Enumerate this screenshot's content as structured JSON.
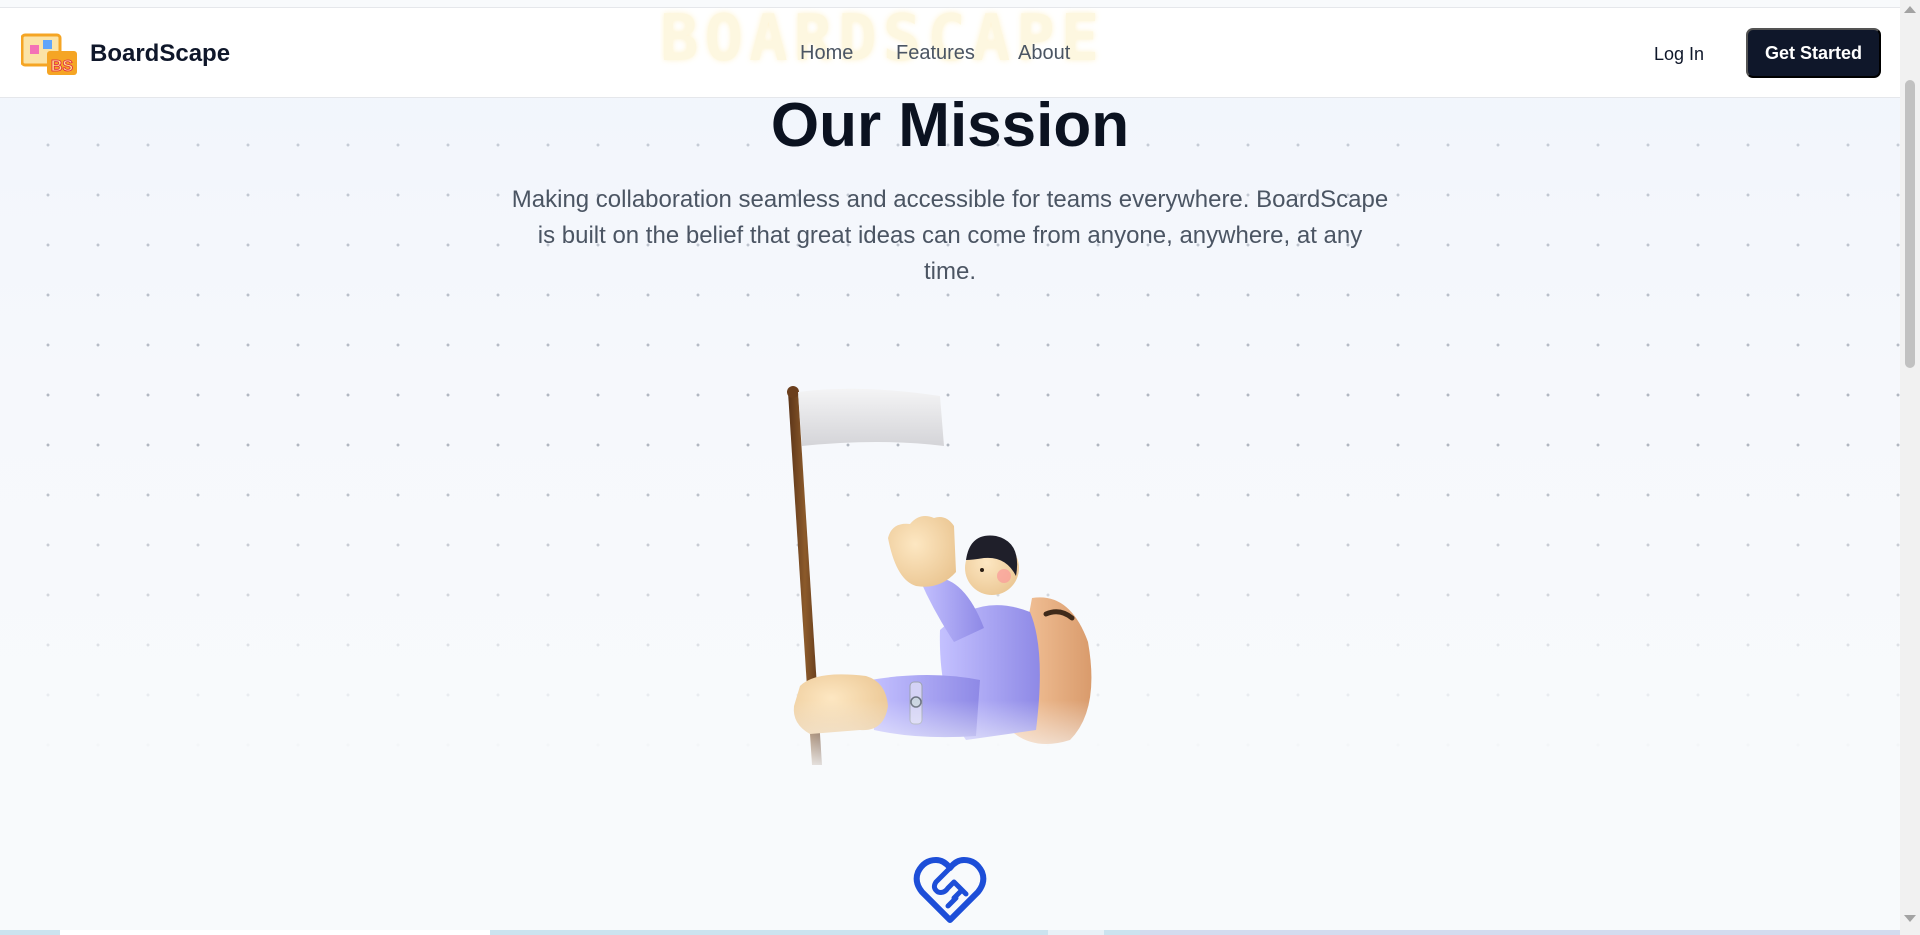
{
  "header": {
    "brand": "BoardScape",
    "logo_text": "BS",
    "ghost_word": "BOARDSCAPE",
    "nav": [
      {
        "label": "Home"
      },
      {
        "label": "Features"
      },
      {
        "label": "About"
      }
    ],
    "login_label": "Log In",
    "cta_label": "Get Started"
  },
  "mission": {
    "title": "Our Mission",
    "subtitle": "Making collaboration seamless and accessible for teams everywhere. BoardScape is built on the belief that great ideas can come from anyone, anywhere, at any time."
  },
  "icons": {
    "mission_illustration": "person-with-flag-illustration",
    "next_section": "heart-handshake-icon"
  },
  "colors": {
    "primary_dark": "#0f172a",
    "accent_blue": "#1d4ed8",
    "figure_lavender": "#a5a0f0",
    "logo_orange": "#f5a524"
  }
}
